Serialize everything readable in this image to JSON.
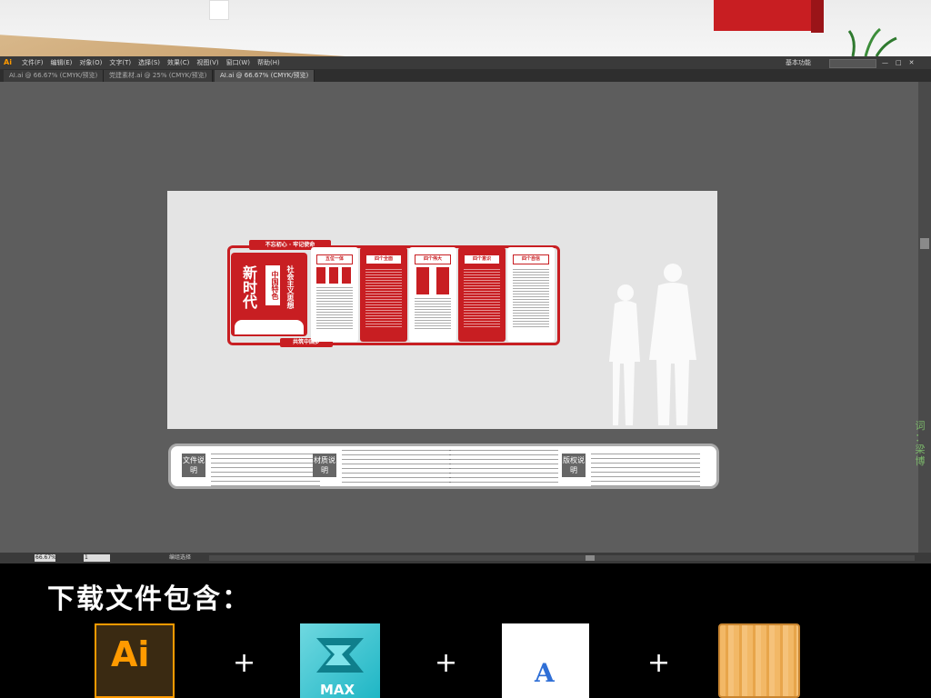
{
  "app": {
    "logo": "Ai",
    "menus": [
      "文件(F)",
      "编辑(E)",
      "对象(O)",
      "文字(T)",
      "选择(S)",
      "效果(C)",
      "视图(V)",
      "窗口(W)",
      "帮助(H)"
    ],
    "workspace_label": "基本功能",
    "window_controls": [
      "—",
      "□",
      "✕"
    ]
  },
  "tabs": [
    {
      "label": "AI.ai @ 66.67% (CMYK/预览)"
    },
    {
      "label": "党建素材.ai @ 25% (CMYK/预览)"
    },
    {
      "label": "AI.ai @ 66.67% (CMYK/预览)"
    }
  ],
  "wall": {
    "top_banner": "不忘初心 · 牢记使命",
    "bottom_banner": "共筑中国梦",
    "title_big": "新时代",
    "title_box": "中国特色",
    "title_side": "社会主义思想",
    "panels": [
      {
        "title": "五位一体"
      },
      {
        "title": "四个全面"
      },
      {
        "title": "四个伟大"
      },
      {
        "title": "四个意识"
      },
      {
        "title": "四个自信"
      }
    ]
  },
  "notes": {
    "labels": [
      "文件说明",
      "材质说明",
      "版权说明"
    ]
  },
  "status": {
    "zoom": "66.67%",
    "page": "1",
    "mode": "编组选择"
  },
  "side_text": [
    "词",
    "：",
    "梁",
    "博"
  ],
  "download": {
    "title": "下载文件包含：",
    "plus": "+",
    "ai_label": "Ai",
    "max_label": "MAX",
    "font_label": "A"
  },
  "colors": {
    "brand_red": "#c81e22",
    "ai_orange": "#ff9a00",
    "max_teal": "#1fb6c5",
    "font_blue": "#2f6fd6",
    "wood": "#e8a54a"
  }
}
